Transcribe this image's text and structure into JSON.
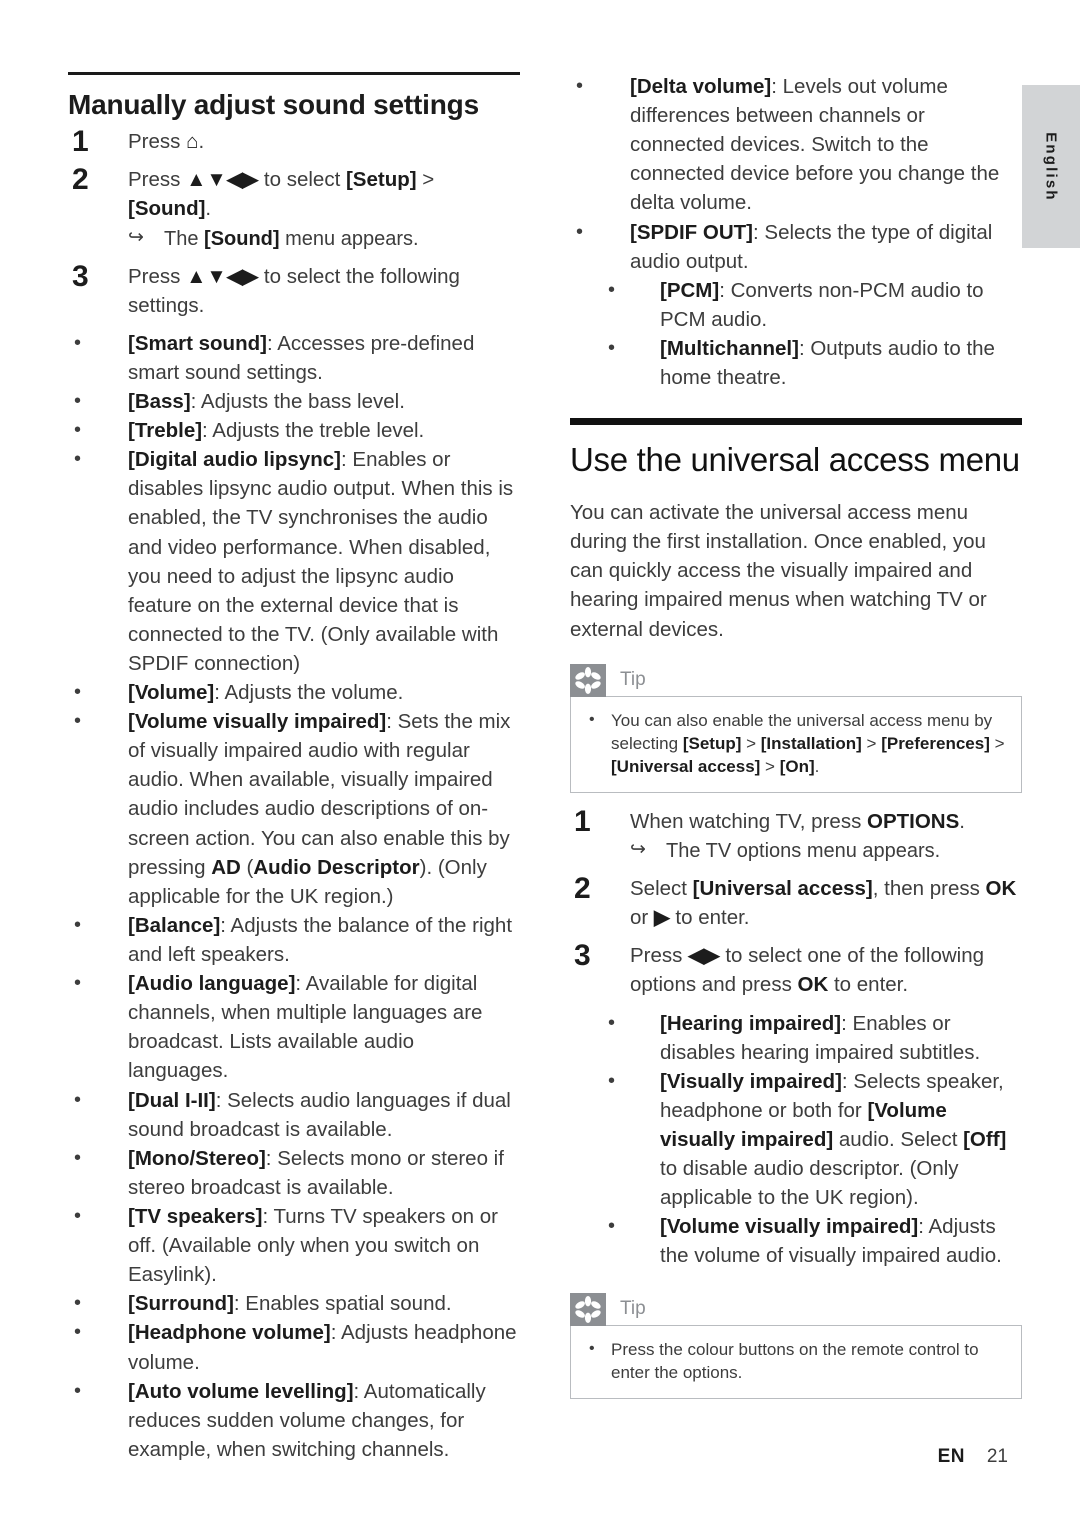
{
  "language_tab": {
    "label": "English"
  },
  "footer": {
    "locale": "EN",
    "page_number": "21"
  },
  "left_column": {
    "heading": "Manually adjust sound settings",
    "steps": [
      {
        "number": "1",
        "text_before": "Press ",
        "symbol": "⌂",
        "text_after": "."
      },
      {
        "number": "2",
        "text_before": "Press ",
        "symbol": "▲▼◀▶",
        "text_after": " to select ",
        "bold1": "[Setup]",
        "mid": " > ",
        "bold2": "[Sound]",
        "tail": ".",
        "substep": {
          "arrow": "↪",
          "text_before": "The ",
          "bold": "[Sound]",
          "text_after": " menu appears."
        }
      },
      {
        "number": "3",
        "text_before": "Press ",
        "symbol": "▲▼◀▶",
        "text_after": " to select the following settings."
      }
    ],
    "settings": [
      {
        "term": "[Smart sound]",
        "desc": ": Accesses pre-defined smart sound settings."
      },
      {
        "term": "[Bass]",
        "desc": ": Adjusts the bass level."
      },
      {
        "term": "[Treble]",
        "desc": ": Adjusts the treble level."
      },
      {
        "term": "[Digital audio lipsync]",
        "desc": ": Enables or disables lipsync audio output. When this is enabled, the TV synchronises the audio and video performance. When disabled, you need to adjust the lipsync audio feature on the external device that is connected to the TV. (Only available with SPDIF connection)"
      },
      {
        "term": "[Volume]",
        "desc": ": Adjusts the volume."
      },
      {
        "term": "[Volume visually impaired]",
        "desc": ": Sets the mix of visually impaired audio with regular audio. When available, visually impaired audio includes audio descriptions of on-screen action. You can also enable this by pressing ",
        "bold_inline_1": "AD",
        "desc_mid": " (",
        "bold_inline_2": "Audio Descriptor",
        "desc_tail": "). (Only applicable for the UK region.)"
      },
      {
        "term": "[Balance]",
        "desc": ": Adjusts the balance of the right and left speakers."
      },
      {
        "term": "[Audio language]",
        "desc": ": Available for digital channels, when multiple languages are broadcast. Lists available audio languages."
      },
      {
        "term": "[Dual I-II]",
        "desc": ": Selects audio languages if dual sound broadcast is available."
      },
      {
        "term": "[Mono/Stereo]",
        "desc": ": Selects mono or stereo if stereo broadcast is available."
      },
      {
        "term": "[TV speakers]",
        "desc": ": Turns TV speakers on or off. (Available only when you switch on Easylink)."
      },
      {
        "term": "[Surround]",
        "desc": ": Enables spatial sound."
      },
      {
        "term": "[Headphone volume]",
        "desc": ": Adjusts headphone volume."
      },
      {
        "term": "[Auto volume levelling]",
        "desc": ": Automatically reduces sudden volume changes, for example, when switching channels."
      }
    ]
  },
  "right_column": {
    "settings_continued": [
      {
        "term": "[Delta volume]",
        "desc": ": Levels out volume differences between channels or connected devices. Switch to the connected device before you change the delta volume."
      },
      {
        "term": "[SPDIF OUT]",
        "desc": ": Selects the type of digital audio output."
      }
    ],
    "spdif_sub_options": [
      {
        "term": "[PCM]",
        "desc": ": Converts non-PCM audio to PCM audio."
      },
      {
        "term": "[Multichannel]",
        "desc": ": Outputs audio to the home theatre."
      }
    ],
    "heading": "Use the universal access menu",
    "intro": "You can activate the universal access menu during the first installation. Once enabled, you can quickly access the visually impaired and hearing impaired menus when watching TV or external devices.",
    "tip_top": {
      "icon_name": "tip-asterisk-icon",
      "label": "Tip",
      "text_before": "You can also enable the universal access menu by selecting ",
      "bold1": "[Setup]",
      "sep1": " > ",
      "bold2": "[Installation]",
      "sep2": " > ",
      "bold3": "[Preferences]",
      "sep3": " > ",
      "bold4": "[Universal access]",
      "sep4": " > ",
      "bold5": "[On]",
      "tail": "."
    },
    "steps": [
      {
        "number": "1",
        "text_before": "When watching TV, press ",
        "bold": "OPTIONS",
        "tail": ".",
        "substep": {
          "arrow": "↪",
          "text": "The TV options menu appears."
        }
      },
      {
        "number": "2",
        "text_before": "Select ",
        "bold": "[Universal access]",
        "mid": ", then press ",
        "bold2": "OK",
        "mid2": " or ",
        "symbol": "▶",
        "tail": " to enter."
      },
      {
        "number": "3",
        "text_before": "Press ",
        "symbol": "◀▶",
        "mid": " to select one of the following options and press ",
        "bold": "OK",
        "tail": " to enter."
      }
    ],
    "access_options": [
      {
        "term": "[Hearing impaired]",
        "desc": ": Enables or disables hearing impaired subtitles."
      },
      {
        "term": "[Visually impaired]",
        "desc": ": Selects speaker, headphone or both for ",
        "bold_inline": "[Volume visually impaired]",
        "desc_mid": " audio. Select ",
        "bold_inline_2": "[Off]",
        "desc_tail": " to disable audio descriptor. (Only applicable to the UK region)."
      },
      {
        "term": "[Volume visually impaired]",
        "desc": ": Adjusts the volume of visually impaired audio."
      }
    ],
    "tip_bottom": {
      "icon_name": "tip-asterisk-icon",
      "label": "Tip",
      "text": "Press the colour buttons on the remote control to enter the options."
    }
  }
}
